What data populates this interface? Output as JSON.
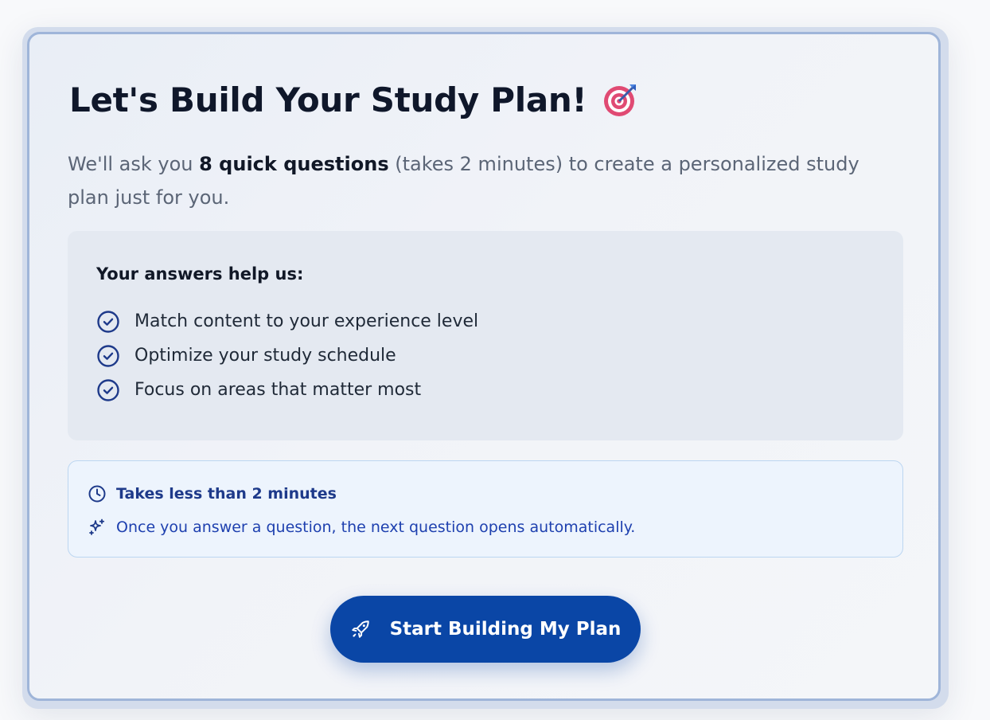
{
  "header": {
    "title": "Let's Build Your Study Plan!",
    "emoji_icon": "target-dart-icon"
  },
  "intro": {
    "prefix": "We'll ask you ",
    "emphasis": "8 quick questions",
    "suffix": " (takes 2 minutes) to create a personalized study plan just for you."
  },
  "benefits": {
    "heading": "Your answers help us:",
    "icon": "check-circle-icon",
    "items": [
      {
        "label": "Match content to your experience level"
      },
      {
        "label": "Optimize your study schedule"
      },
      {
        "label": "Focus on areas that matter most"
      }
    ]
  },
  "info": {
    "time": {
      "icon": "clock-icon",
      "label": "Takes less than 2 minutes"
    },
    "auto": {
      "icon": "sparkles-icon",
      "label": "Once you answer a question, the next question opens automatically."
    }
  },
  "cta": {
    "icon": "rocket-icon",
    "label": "Start Building My Plan"
  },
  "colors": {
    "accent": "#0a46a6",
    "card_border": "#9fb5d9",
    "info_text": "#1e40af",
    "icon_blue": "#1e3a8a"
  }
}
